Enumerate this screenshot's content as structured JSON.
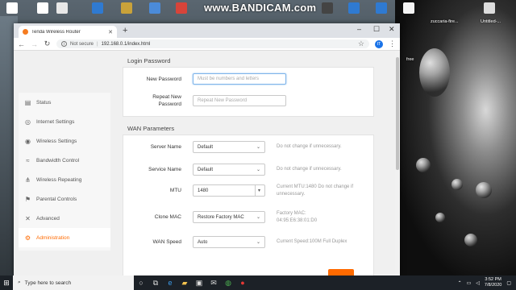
{
  "desktop": {
    "watermark": "www.BANDICAM.com",
    "labels": [
      "zuccaria-fire...",
      "Untitled-...",
      "free"
    ]
  },
  "browser": {
    "tab_title": "Tenda Wireless Router",
    "security_label": "Not secure",
    "separator": "|",
    "url": "192.168.0.1/index.html",
    "profile_initial": "IT"
  },
  "sidebar": {
    "items": [
      {
        "label": "Status",
        "icon": "status-icon"
      },
      {
        "label": "Internet Settings",
        "icon": "internet-icon"
      },
      {
        "label": "Wireless Settings",
        "icon": "wireless-icon"
      },
      {
        "label": "Bandwidth Control",
        "icon": "bandwidth-icon"
      },
      {
        "label": "Wireless Repeating",
        "icon": "repeating-icon"
      },
      {
        "label": "Parental Controls",
        "icon": "parental-icon"
      },
      {
        "label": "Advanced",
        "icon": "tools-icon"
      },
      {
        "label": "Administration",
        "icon": "gear-icon"
      }
    ],
    "active_index": 7
  },
  "login": {
    "title": "Login Password",
    "new_password_label": "New Password",
    "new_password_placeholder": "Must be numbers and letters",
    "repeat_label_1": "Repeat New",
    "repeat_label_2": "Password",
    "repeat_placeholder": "Repeat New Password"
  },
  "wan": {
    "title": "WAN Parameters",
    "server_name": {
      "label": "Server Name",
      "value": "Default",
      "hint": "Do not change if unnecessary."
    },
    "service_name": {
      "label": "Service Name",
      "value": "Default",
      "hint": "Do not change if unnecessary."
    },
    "mtu": {
      "label": "MTU",
      "value": "1480",
      "hint_1": "Current MTU:1480 Do not change if",
      "hint_2": "unnecessary."
    },
    "clone_mac": {
      "label": "Clone MAC",
      "value": "Restore Factory MAC",
      "hint_1": "Factory MAC:",
      "hint_2": "04:95:E6:38:01:D0"
    },
    "wan_speed": {
      "label": "WAN Speed",
      "value": "Auto",
      "hint": "Current Speed:100M Full Duplex"
    }
  },
  "taskbar": {
    "search_placeholder": "Type here to search",
    "time": "3:52 PM",
    "date": "7/8/2020"
  },
  "colors": {
    "accent": "#ff6a00",
    "focus": "#7eb4ea"
  }
}
